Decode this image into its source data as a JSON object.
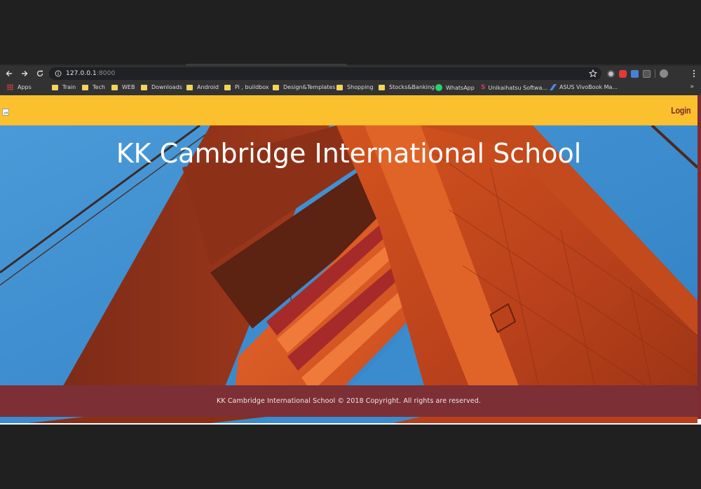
{
  "browser": {
    "url_host": "127.0.0.1",
    "url_port": ":8000",
    "bookmarks": [
      {
        "label": "Apps",
        "icon": "apps-grid-icon"
      },
      {
        "label": "Train",
        "icon": "folder-icon"
      },
      {
        "label": "Tech",
        "icon": "folder-icon"
      },
      {
        "label": "WEB",
        "icon": "folder-icon"
      },
      {
        "label": "Downloads",
        "icon": "folder-icon"
      },
      {
        "label": "Android",
        "icon": "folder-icon"
      },
      {
        "label": "Pi , buildbox",
        "icon": "folder-icon"
      },
      {
        "label": "Design&Templates",
        "icon": "folder-icon"
      },
      {
        "label": "Shopping",
        "icon": "folder-icon"
      },
      {
        "label": "Stocks&Banking",
        "icon": "folder-icon"
      },
      {
        "label": "WhatsApp",
        "icon": "whatsapp-icon"
      },
      {
        "label": "Unikaihatsu Softwa...",
        "icon": "unikaihatsu-icon"
      },
      {
        "label": "ASUS VivoBook Ma...",
        "icon": "asus-icon"
      }
    ],
    "more_label": "»"
  },
  "navbar": {
    "login_label": "Login",
    "color": "#fbc02d"
  },
  "hero": {
    "title": "KK Cambridge International School"
  },
  "footer": {
    "text": "KK Cambridge International School © 2018 Copyright. All rights are reserved.",
    "color": "#7c2f35"
  }
}
